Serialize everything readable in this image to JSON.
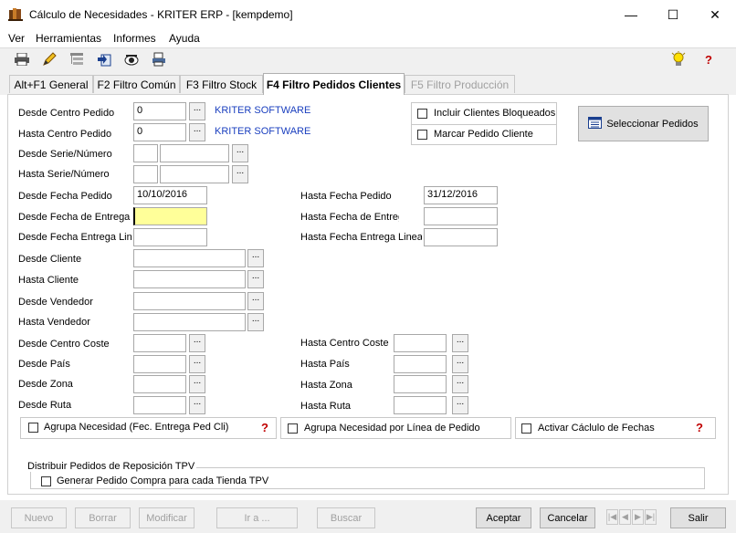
{
  "window": {
    "title": "Cálculo de Necesidades - KRITER ERP - [kempdemo]",
    "minimize": "—",
    "maximize": "☐",
    "close": "✕"
  },
  "menu": [
    "Ver",
    "Herramientas",
    "Informes",
    "Ayuda"
  ],
  "tabs": [
    {
      "label": "Alt+F1 General"
    },
    {
      "label": "F2 Filtro Común"
    },
    {
      "label": "F3 Filtro Stock"
    },
    {
      "label": "F4 Filtro Pedidos Clientes"
    },
    {
      "label": "F5 Filtro Producción"
    }
  ],
  "form": {
    "desde_centro_pedido": {
      "label": "Desde Centro Pedido",
      "value": "0",
      "desc": "KRITER SOFTWARE"
    },
    "hasta_centro_pedido": {
      "label": "Hasta Centro Pedido",
      "value": "0",
      "desc": "KRITER SOFTWARE"
    },
    "desde_serie": {
      "label": "Desde Serie/Número",
      "serie": "",
      "numero": ""
    },
    "hasta_serie": {
      "label": "Hasta Serie/Número",
      "serie": "",
      "numero": ""
    },
    "desde_fecha_pedido": {
      "label": "Desde Fecha Pedido",
      "value": "10/10/2016"
    },
    "hasta_fecha_pedido": {
      "label": "Hasta Fecha Pedido",
      "value": "31/12/2016"
    },
    "desde_fecha_entrega": {
      "label": "Desde Fecha de Entrega",
      "value": ""
    },
    "hasta_fecha_entrega": {
      "label": "Hasta Fecha de Entrega",
      "value": ""
    },
    "desde_fecha_entrega_linea": {
      "label": "Desde Fecha Entrega Linea",
      "value": ""
    },
    "hasta_fecha_entrega_linea": {
      "label": "Hasta Fecha Entrega Linea",
      "value": ""
    },
    "desde_cliente": {
      "label": "Desde Cliente",
      "value": ""
    },
    "hasta_cliente": {
      "label": "Hasta Cliente",
      "value": ""
    },
    "desde_vendedor": {
      "label": "Desde Vendedor",
      "value": ""
    },
    "hasta_vendedor": {
      "label": "Hasta Vendedor",
      "value": ""
    },
    "desde_centro_coste": {
      "label": "Desde Centro Coste",
      "value": ""
    },
    "hasta_centro_coste": {
      "label": "Hasta Centro Coste",
      "value": ""
    },
    "desde_pais": {
      "label": "Desde País",
      "value": ""
    },
    "hasta_pais": {
      "label": "Hasta País",
      "value": ""
    },
    "desde_zona": {
      "label": "Desde Zona",
      "value": ""
    },
    "hasta_zona": {
      "label": "Hasta Zona",
      "value": ""
    },
    "desde_ruta": {
      "label": "Desde Ruta",
      "value": ""
    },
    "hasta_ruta": {
      "label": "Hasta Ruta",
      "value": ""
    },
    "dots": "..."
  },
  "options": {
    "incluir_bloqueados": "Incluir Clientes Bloqueados",
    "marcar_pedido": "Marcar Pedido Cliente",
    "seleccionar_pedidos": "Seleccionar Pedidos",
    "agrupa_fecha": "Agrupa Necesidad (Fec. Entrega Ped Cli)",
    "agrupa_linea": "Agrupa Necesidad por Línea de Pedido",
    "activar_calculo": "Activar Cáclulo de Fechas",
    "distribuir_group": "Distribuir Pedidos de Reposición TPV",
    "generar_pedido": "Generar Pedido Compra para cada Tienda TPV",
    "help": "?"
  },
  "buttons": {
    "nuevo": "Nuevo",
    "borrar": "Borrar",
    "modificar": "Modificar",
    "ir_a": "Ir a ...",
    "buscar": "Buscar",
    "aceptar": "Aceptar",
    "cancelar": "Cancelar",
    "salir": "Salir"
  },
  "nav": {
    "first": "|◀",
    "prev": "◀",
    "next": "▶",
    "last": "▶|"
  },
  "colors": {
    "accent_blue": "#1a3fbf",
    "highlight_yellow": "#ffff99",
    "help_red": "#c00000"
  }
}
